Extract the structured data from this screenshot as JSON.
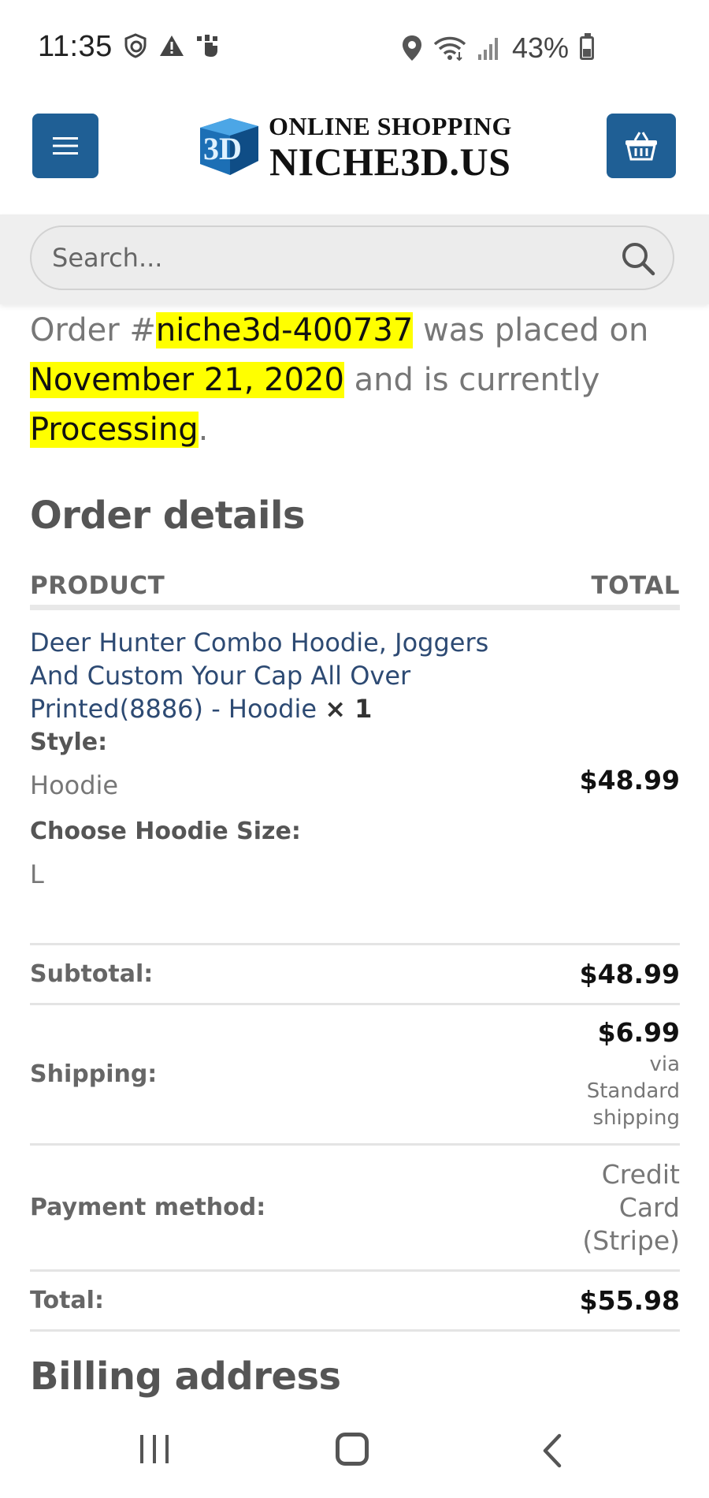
{
  "status_bar": {
    "time": "11:35",
    "battery": "43%",
    "battery_level": 0.43
  },
  "header": {
    "logo_line1": "ONLINE SHOPPING",
    "logo_line2": "NICHE3D.US",
    "logo_badge": "3D"
  },
  "search": {
    "placeholder": "Search..."
  },
  "order_status": {
    "prefix": "Order #",
    "order_id": "niche3d-400737",
    "mid": " was placed on ",
    "date": "November 21, 2020",
    "mid2": " and is currently ",
    "status": "Processing",
    "suffix": "."
  },
  "order_details": {
    "title": "Order details",
    "col_product": "PRODUCT",
    "col_total": "TOTAL",
    "item": {
      "name": "Deer Hunter Combo Hoodie, Joggers And Custom Your Cap All Over Printed(8886) - Hoodie",
      "qty": "× 1",
      "style_label": "Style:",
      "style_value": "Hoodie",
      "size_label": "Choose Hoodie Size:",
      "size_value": "L",
      "price": "$48.99"
    },
    "subtotal_label": "Subtotal:",
    "subtotal_value": "$48.99",
    "shipping_label": "Shipping:",
    "shipping_value": "$6.99",
    "shipping_via_1": "via",
    "shipping_via_2": "Standard",
    "shipping_via_3": "shipping",
    "payment_label": "Payment method:",
    "payment_value_1": "Credit",
    "payment_value_2": "Card",
    "payment_value_3": "(Stripe)",
    "total_label": "Total:",
    "total_value": "$55.98"
  },
  "billing": {
    "title": "Billing address"
  },
  "colors": {
    "brand_blue": "#1f5f95",
    "highlight": "#ffff00",
    "link": "#2d4a73"
  }
}
